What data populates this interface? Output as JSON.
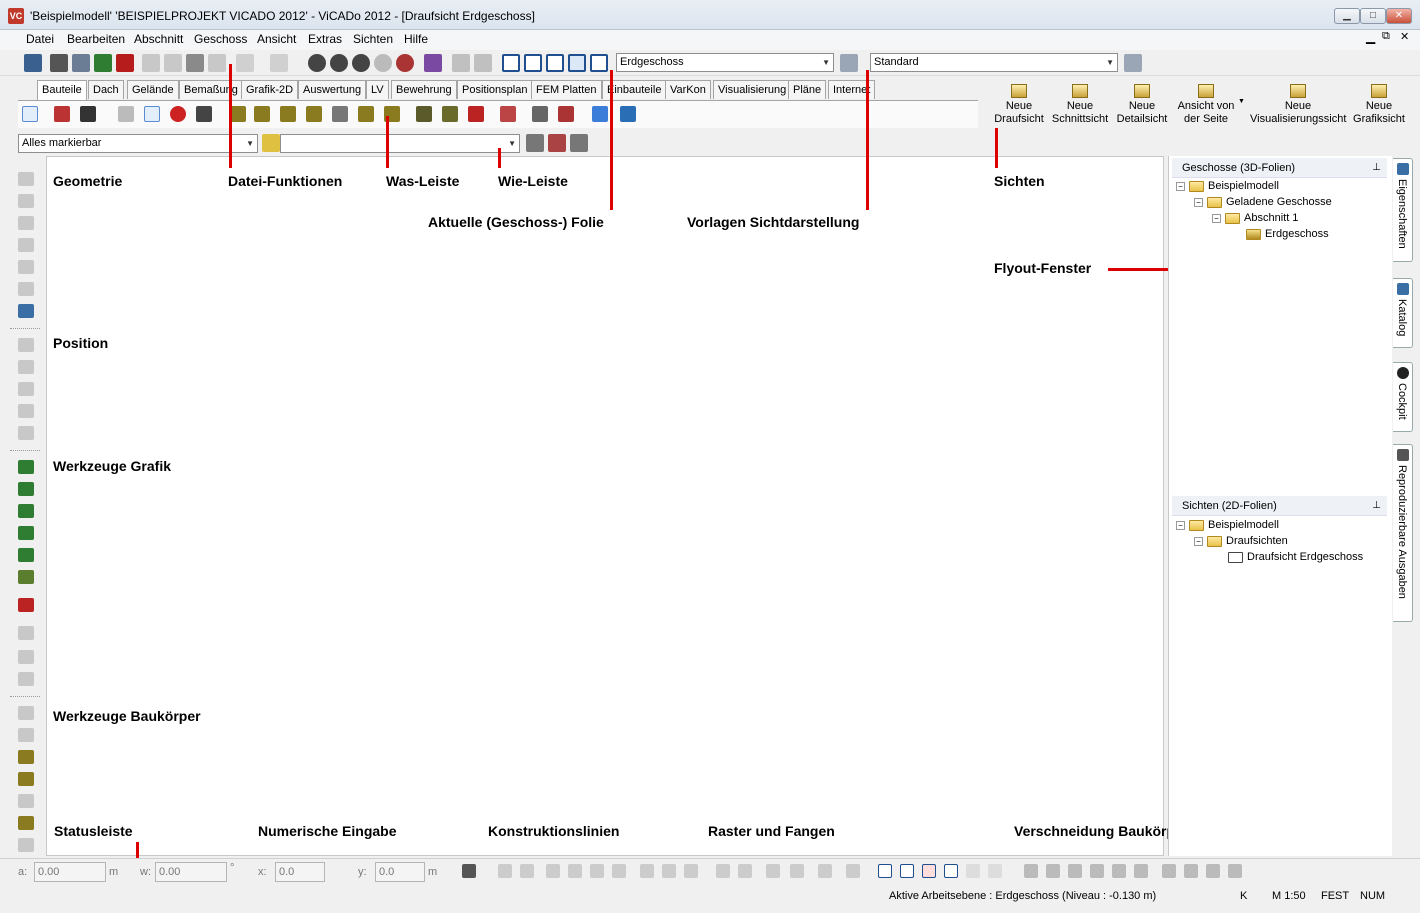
{
  "window": {
    "title": "'Beispielmodell' 'BEISPIELPROJEKT VICADO 2012' - ViCADo 2012 - [Draufsicht Erdgeschoss]",
    "app_icon": "VC",
    "btn_min": "▁",
    "btn_max": "□",
    "btn_close": "✕"
  },
  "menu": [
    "Datei",
    "Bearbeiten",
    "Abschnitt",
    "Geschoss",
    "Ansicht",
    "Extras",
    "Sichten",
    "Hilfe"
  ],
  "toolbar": {
    "floor_combo": "Erdgeschoss",
    "style_combo": "Standard"
  },
  "ribbon": {
    "tabs": [
      "Bauteile",
      "Dach",
      "Gelände",
      "Bemaßung",
      "Grafik-2D",
      "Auswertung",
      "LV",
      "Bewehrung",
      "Positionsplan",
      "FEM Platten",
      "Einbauteile",
      "VarKon",
      "Visualisierung",
      "Pläne",
      "Internet"
    ],
    "active_tab": "Bauteile",
    "sicht_buttons": [
      {
        "label1": "Neue",
        "label2": "Draufsicht"
      },
      {
        "label1": "Neue",
        "label2": "Schnittsicht"
      },
      {
        "label1": "Neue",
        "label2": "Detailsicht"
      },
      {
        "label1": "Ansicht von",
        "label2": "der Seite"
      },
      {
        "label1": "Neue",
        "label2": "Visualisierungssicht"
      },
      {
        "label1": "Neue",
        "label2": "Grafiksicht"
      }
    ]
  },
  "filter": {
    "selection_combo": "Alles markierbar",
    "wie_combo": ""
  },
  "annotations": {
    "geometrie": "Geometrie",
    "datei_funktionen": "Datei-Funktionen",
    "was_leiste": "Was-Leiste",
    "wie_leiste": "Wie-Leiste",
    "aktuelle_folie": "Aktuelle (Geschoss-) Folie",
    "vorlagen": "Vorlagen Sichtdarstellung",
    "sichten": "Sichten",
    "flyout": "Flyout-Fenster",
    "position": "Position",
    "werkzeuge_grafik": "Werkzeuge Grafik",
    "werkzeuge_baukoerper": "Werkzeuge Baukörper",
    "statusleiste": "Statusleiste",
    "numerische_eingabe": "Numerische Eingabe",
    "konstruktionslinien": "Konstruktionslinien",
    "raster_fangen": "Raster und Fangen",
    "verschneidung": "Verschneidung Baukörper"
  },
  "panels": {
    "geschosse": {
      "title": "Geschosse (3D-Folien)",
      "nodes": [
        "Beispielmodell",
        "Geladene Geschosse",
        "Abschnitt 1",
        "Erdgeschoss"
      ]
    },
    "sichten": {
      "title": "Sichten (2D-Folien)",
      "nodes": [
        "Beispielmodell",
        "Draufsichten",
        "Draufsicht Erdgeschoss"
      ]
    },
    "pin": "⊥"
  },
  "side_tabs": [
    "Eigenschaften",
    "Katalog",
    "Cockpit",
    "Reproduzierbare Ausgaben"
  ],
  "statusbar": {
    "a_label": "a:",
    "a_value": "0.00",
    "a_unit": "m",
    "w_label": "w:",
    "w_value": "0.00",
    "w_unit": "°",
    "x_label": "x:",
    "x_value": "0.0",
    "y_label": "y:",
    "y_value": "0.0",
    "y_unit": "m",
    "active_level": "Aktive Arbeitsebene : Erdgeschoss (Niveau : -0.130 m)",
    "k": "K",
    "scale": "M 1:50",
    "fest": "FEST",
    "num": "NUM"
  }
}
